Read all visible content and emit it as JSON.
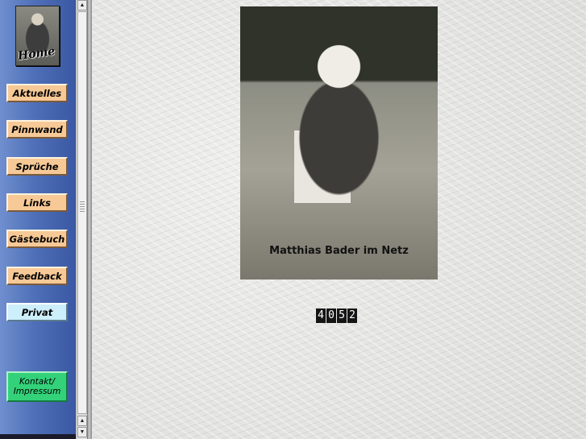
{
  "nav": {
    "home_label": "Home",
    "items": [
      {
        "label": "Aktuelles"
      },
      {
        "label": "Pinnwand"
      },
      {
        "label": "Sprüche"
      },
      {
        "label": "Links"
      },
      {
        "label": "Gästebuch"
      },
      {
        "label": "Feedback"
      },
      {
        "label": "Privat"
      }
    ],
    "kontakt": {
      "line1": "Kontakt/",
      "line2": "Impressum"
    }
  },
  "scrollbar": {
    "up_icon": "arrow-up-icon",
    "down_icon": "arrow-down-icon"
  },
  "content": {
    "photo_caption": "Matthias Bader im Netz",
    "counter": [
      "4",
      "0",
      "5",
      "2"
    ]
  },
  "colors": {
    "nav_button": "#f7c996",
    "privat_button": "#cdeefb",
    "kontakt_button": "#33d27a",
    "nav_background": "#4f6fb8"
  }
}
